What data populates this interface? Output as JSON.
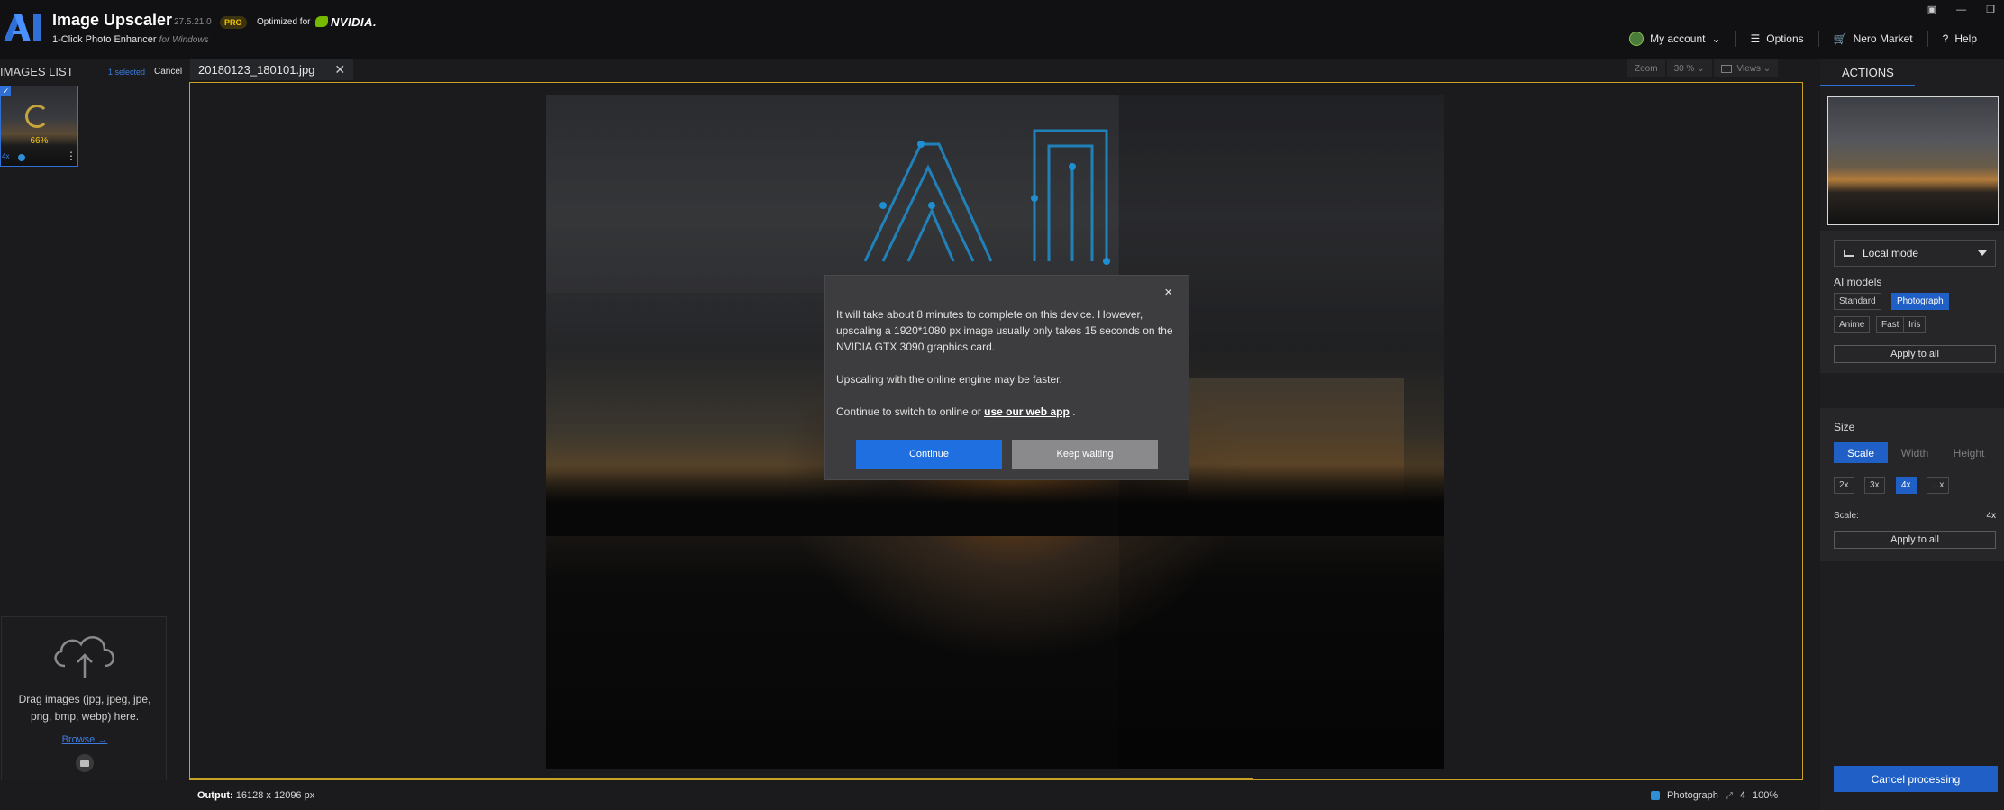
{
  "app": {
    "title": "Image Upscaler",
    "version": "27.5.21.0",
    "pro_badge": "PRO",
    "optimized_for": "Optimized for",
    "nvidia": "NVIDIA.",
    "subtitle": "1-Click Photo Enhancer",
    "subtitle_suffix": "for Windows"
  },
  "nav": {
    "account": "My account",
    "options": "Options",
    "market": "Nero Market",
    "help": "Help"
  },
  "images_list": {
    "title": "IMAGES LIST",
    "selected": "1 selected",
    "cancel": "Cancel",
    "items": [
      {
        "progress": "66%",
        "scale": "4x"
      }
    ]
  },
  "drop_zone": {
    "text": "Drag images (jpg, jpeg, jpe, png, bmp, webp) here.",
    "browse": "Browse →"
  },
  "tab": {
    "filename": "20180123_180101.jpg",
    "close": "✕"
  },
  "view": {
    "zoom_label": "Zoom",
    "zoom_value": "30 %",
    "views_label": "Views"
  },
  "dialog": {
    "message": "It will take about 8 minutes to complete on this device. However, upscaling a 1920*1080 px image usually only takes 15 seconds on the NVIDIA GTX 3090 graphics card.",
    "online_note": "Upscaling with the online engine may be faster.",
    "switch_prefix": "Continue to switch to online or",
    "switch_link": "use our web app",
    "switch_suffix": ".",
    "continue": "Continue",
    "keep_waiting": "Keep waiting",
    "close": "×"
  },
  "status": {
    "output_label": "Output:",
    "output_value": "16128 x 12096 px",
    "model": "Photograph",
    "scale": "4",
    "zoom": "100%",
    "progress_fraction": 0.66
  },
  "actions": {
    "header": "ACTIONS",
    "mode": "Local mode",
    "ai_models_label": "AI models",
    "models": [
      "Standard",
      "Photograph",
      "Anime",
      "Fast",
      "Iris"
    ],
    "selected_model": "Photograph",
    "apply_all": "Apply to all",
    "size_label": "Size",
    "size_tabs": [
      "Scale",
      "Width",
      "Height"
    ],
    "size_selected": "Scale",
    "scales": [
      "2x",
      "3x",
      "4x",
      "...x"
    ],
    "scale_selected": "4x",
    "scale_label": "Scale:",
    "scale_value": "4x",
    "apply_all_size": "Apply to all",
    "cancel_processing": "Cancel processing"
  },
  "colors": {
    "accent": "#1f5fc6",
    "frame": "#c8a225",
    "pro": "#f2c200",
    "nvidia_green": "#76b900"
  }
}
